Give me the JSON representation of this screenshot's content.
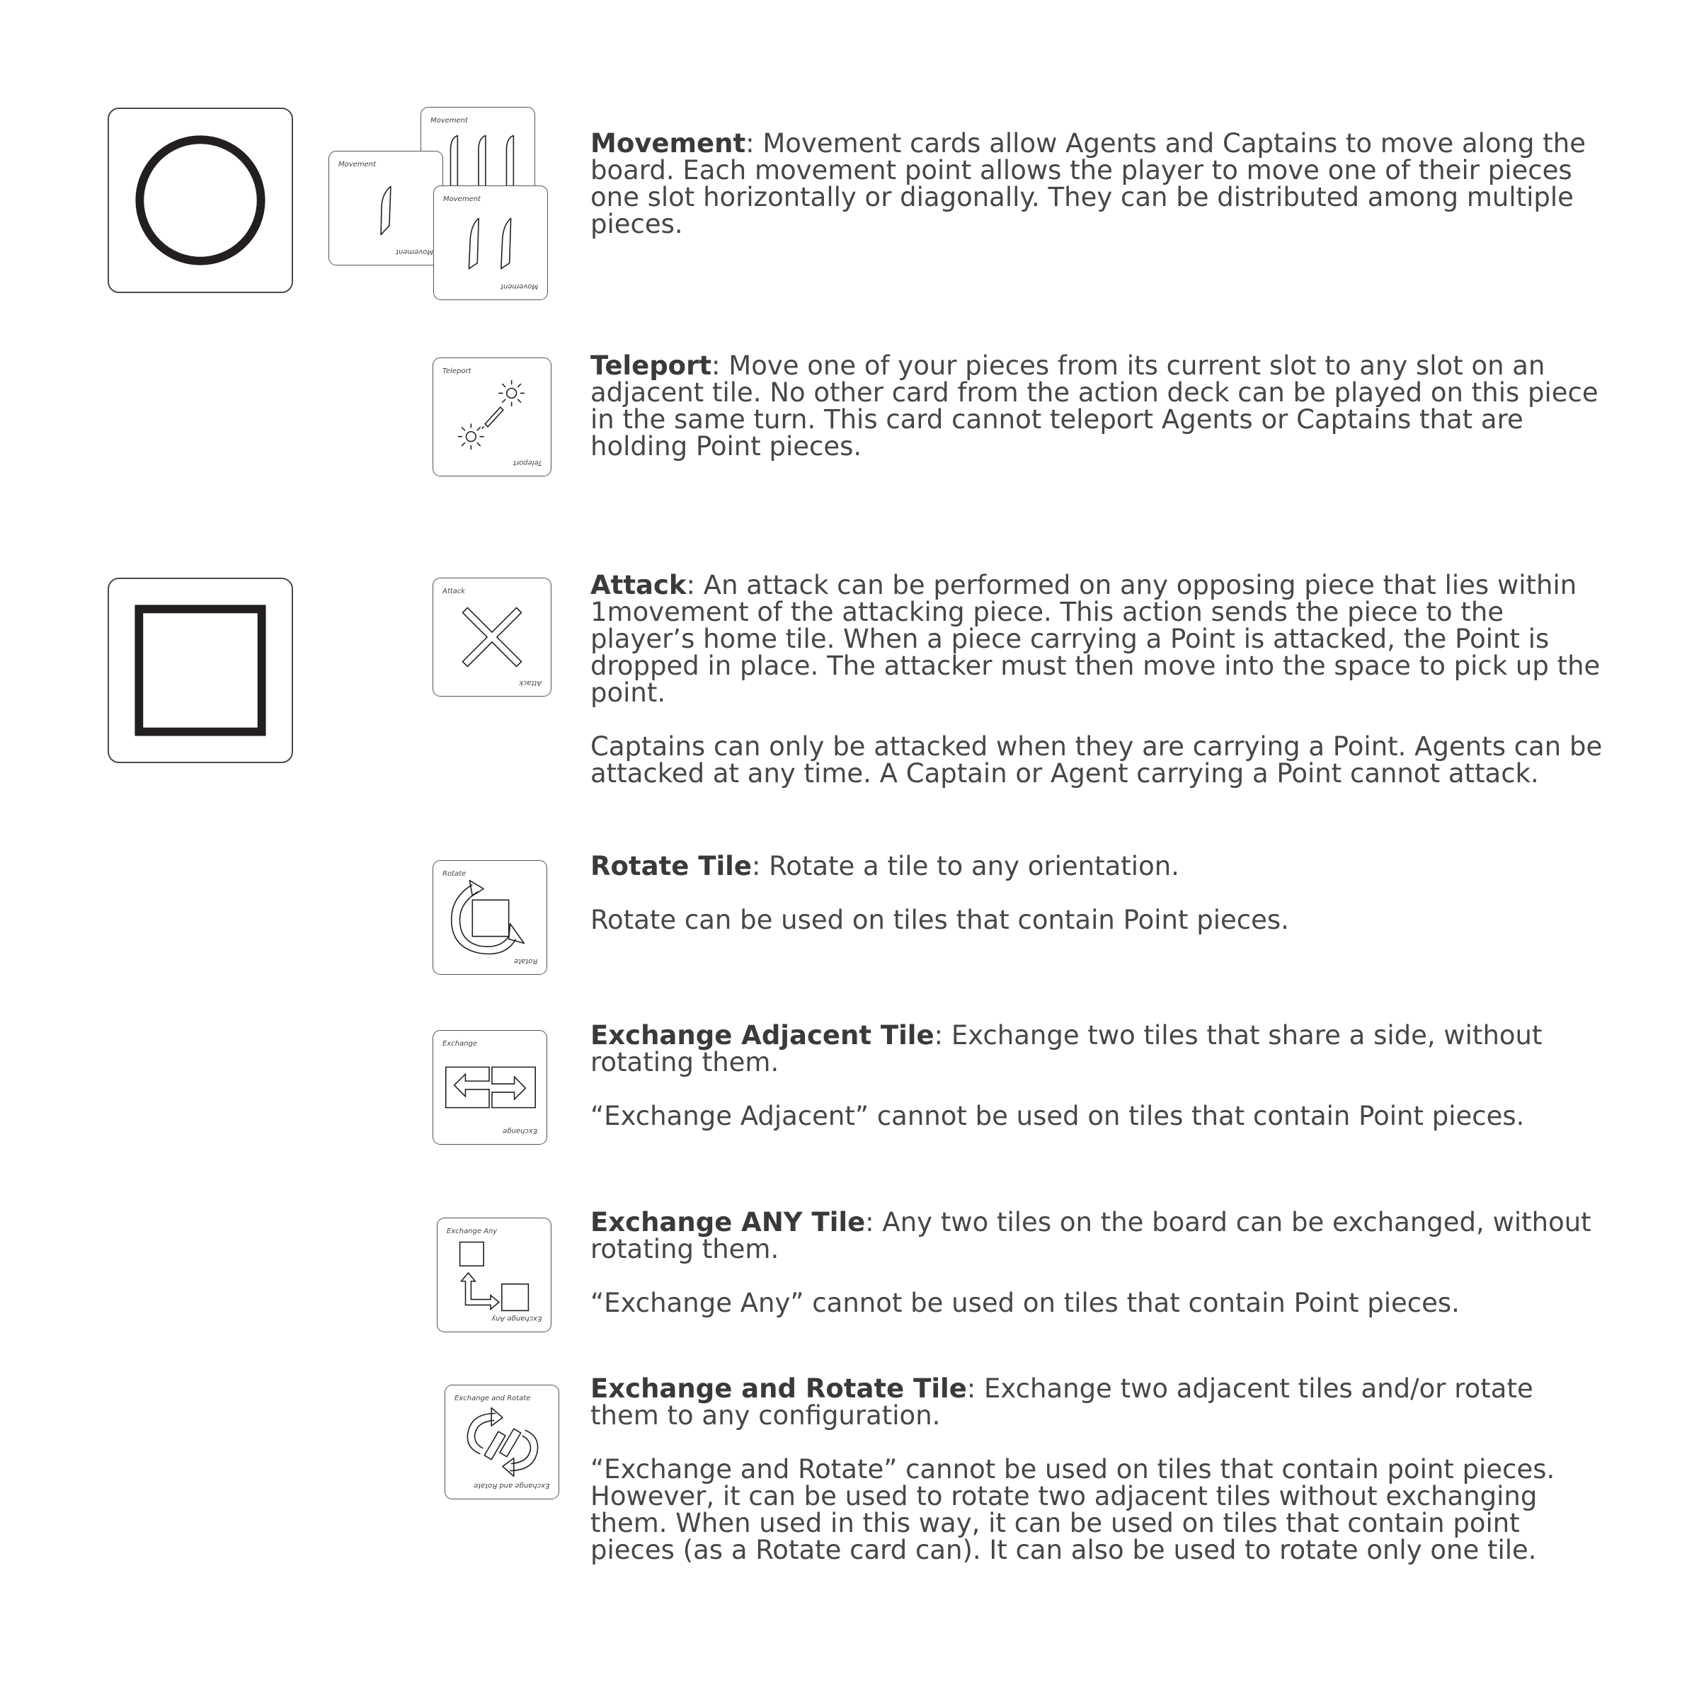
{
  "tiles": {
    "circle_tile": "circle-tile",
    "square_tile": "square-tile"
  },
  "cards": {
    "movement": {
      "label": "Movement"
    },
    "teleport": {
      "label": "Teleport"
    },
    "attack": {
      "label": "Attack"
    },
    "rotate": {
      "label": "Rotate"
    },
    "exchange": {
      "label": "Exchange"
    },
    "exchange_any": {
      "label": "Exchange Any"
    },
    "exchange_rotate": {
      "label": "Exchange and Rotate"
    }
  },
  "rules": {
    "movement": {
      "title": "Movement",
      "body": ": Movement cards allow Agents and Captains to move along the board. Each movement point allows the player to move one of their pieces one slot horizontally or diagonally. They can be distributed among multiple pieces."
    },
    "teleport": {
      "title": "Teleport",
      "body": ": Move one of your pieces from its current slot to any slot on an adjacent tile. No other card from the action deck can be played on this piece in the same turn. This card cannot teleport Agents or Captains that are holding Point pieces."
    },
    "attack": {
      "title": "Attack",
      "body": ": An attack can be performed on any opposing piece that lies within 1movement of the attacking piece. This action sends the piece to the player’s home tile. When a piece carrying a Point is attacked, the Point is dropped in place. The attacker must then move into the space to pick up the point.",
      "note": "Captains can only be attacked when they are carrying a Point. Agents can be attacked at any time. A Captain or Agent carrying a Point cannot attack."
    },
    "rotate": {
      "title": "Rotate Tile",
      "body": ": Rotate a tile to any orientation.",
      "note": "Rotate can be used on tiles that contain Point pieces."
    },
    "exchange": {
      "title": "Exchange Adjacent Tile",
      "body": ": Exchange two tiles that share a side, without rotating them.",
      "note": "“Exchange Adjacent” cannot be used on tiles that contain Point pieces."
    },
    "exchange_any": {
      "title": "Exchange ANY Tile",
      "body": ": Any two tiles on the board can be exchanged, without rotating them.",
      "note": "“Exchange Any” cannot be used on tiles that contain Point pieces."
    },
    "exchange_rotate": {
      "title": "Exchange and Rotate Tile",
      "body": ": Exchange two adjacent tiles and/or rotate them to any configuration.",
      "note": "“Exchange and Rotate” cannot be used on tiles that contain point pieces. However, it can be used to rotate two adjacent tiles without exchanging them. When used in this way, it can be used on tiles that contain point pieces (as a Rotate card can). It can also be used to rotate only one tile."
    }
  }
}
